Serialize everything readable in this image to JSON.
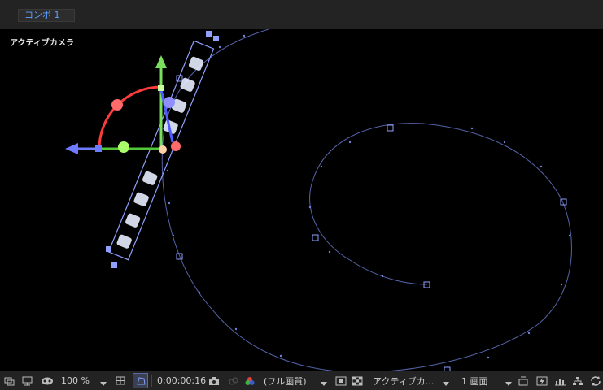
{
  "tab": {
    "label": "コンポ 1"
  },
  "viewer": {
    "camera_label": "アクティブカメラ"
  },
  "toolbar": {
    "zoom": "100 %",
    "timecode": "0;00;00;16",
    "resolution": "(フル画質)",
    "view": "アクティブカ...",
    "layout": "1 画面"
  },
  "colors": {
    "motion_path": "#6f82d8",
    "x_axis": "#6f7bff",
    "y_axis": "#79e05d",
    "z_axis": "#ff6a6a",
    "accent_text": "#5ea1ff"
  }
}
